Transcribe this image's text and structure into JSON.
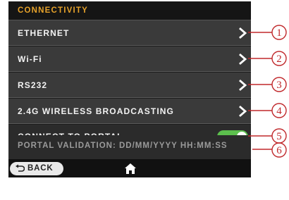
{
  "section": {
    "title": "CONNECTIVITY"
  },
  "menu": {
    "items": [
      {
        "label": "ETHERNET",
        "icon": "chevron-right-icon"
      },
      {
        "label": "Wi-Fi",
        "icon": "chevron-right-icon"
      },
      {
        "label": "RS232",
        "icon": "chevron-right-icon"
      },
      {
        "label": "2.4G WIRELESS BROADCASTING",
        "icon": "chevron-right-icon"
      }
    ],
    "portal": {
      "label": "CONNECT TO PORTAL",
      "toggle_on": true,
      "toggle_color": "#5cbf4d"
    },
    "validation": {
      "label": "PORTAL VALIDATION: DD/MM/YYYY HH:MM:SS"
    }
  },
  "bottom_bar": {
    "back_label": "BACK",
    "back_icon": "back-arrow-icon",
    "home_icon": "home-icon"
  },
  "callouts": {
    "numbers": [
      "1",
      "2",
      "3",
      "4",
      "5",
      "6"
    ],
    "color": "#c0282b"
  },
  "colors": {
    "accent": "#e6a22a",
    "row_bg": "#3a3a3a",
    "screen_bg": "#1c1c1c"
  }
}
